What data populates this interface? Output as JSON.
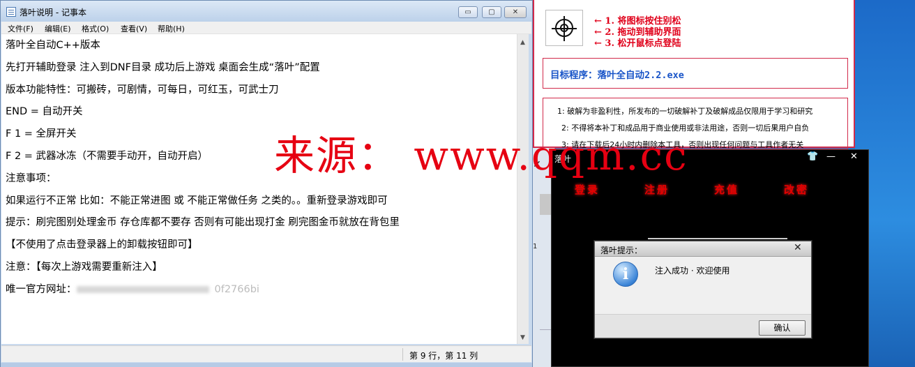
{
  "notepad": {
    "title": "落叶说明 - 记事本",
    "menu": [
      "文件(F)",
      "编辑(E)",
      "格式(O)",
      "查看(V)",
      "帮助(H)"
    ],
    "window_buttons": {
      "minimize": "▭",
      "maximize": "▢",
      "close": "✕"
    },
    "lines": [
      "落叶全自动C++版本",
      "先打开辅助登录  注入到DNF目录 成功后上游戏 桌面会生成“落叶”配置",
      "版本功能特性：可搬砖，可剧情，可每日，可红玉，可武士刀",
      "END = 自动开关",
      "F 1 = 全屏开关",
      "F 2 = 武器冰冻（不需要手动开，自动开启）",
      "注意事项：",
      "如果运行不正常 比如：不能正常进图 或 不能正常做任务 之类的。。重新登录游戏即可",
      "提示：刷完图别处理金币  存仓库都不要存 否则有可能出现打金 刷完图金币就放在背包里",
      "【不使用了点击登录器上的卸载按钮即可】",
      "注意：【每次上游戏需要重新注入】"
    ],
    "official_site_label": "唯一官方网址：",
    "official_site_value": "0f2766bi",
    "status": "第 9 行，第 11 列"
  },
  "watermark": "来源：  www.qqm.cc",
  "helper": {
    "steps": [
      "←  1. 将图标按住别松",
      "←  2. 拖动到辅助界面",
      "←  3. 松开鼠标点登陆"
    ],
    "target_program": "目标程序：落叶全自动2.2.exe",
    "disclaimer": [
      "1: 破解为非盈利性，所发布的一切破解补丁及破解成品仅限用于学习和研究",
      "2: 不得将本补丁和成品用于商业使用或非法用途，否则一切后果用户自负",
      "3: 请在下载后24小时内删除本工具，否则出现任何问题与工具作者无关"
    ]
  },
  "back_window": {
    "close": "✕",
    "line_number": "1"
  },
  "app": {
    "title": "落叶",
    "tabs": [
      "登录",
      "注册",
      "充值",
      "改密"
    ],
    "icons": {
      "shirt": "👕",
      "minimize": "—",
      "close": "✕"
    }
  },
  "dialog": {
    "title": "落叶提示：",
    "close": "✕",
    "icon": "i",
    "message": "注入成功 · 欢迎使用",
    "ok_label": "确认"
  }
}
